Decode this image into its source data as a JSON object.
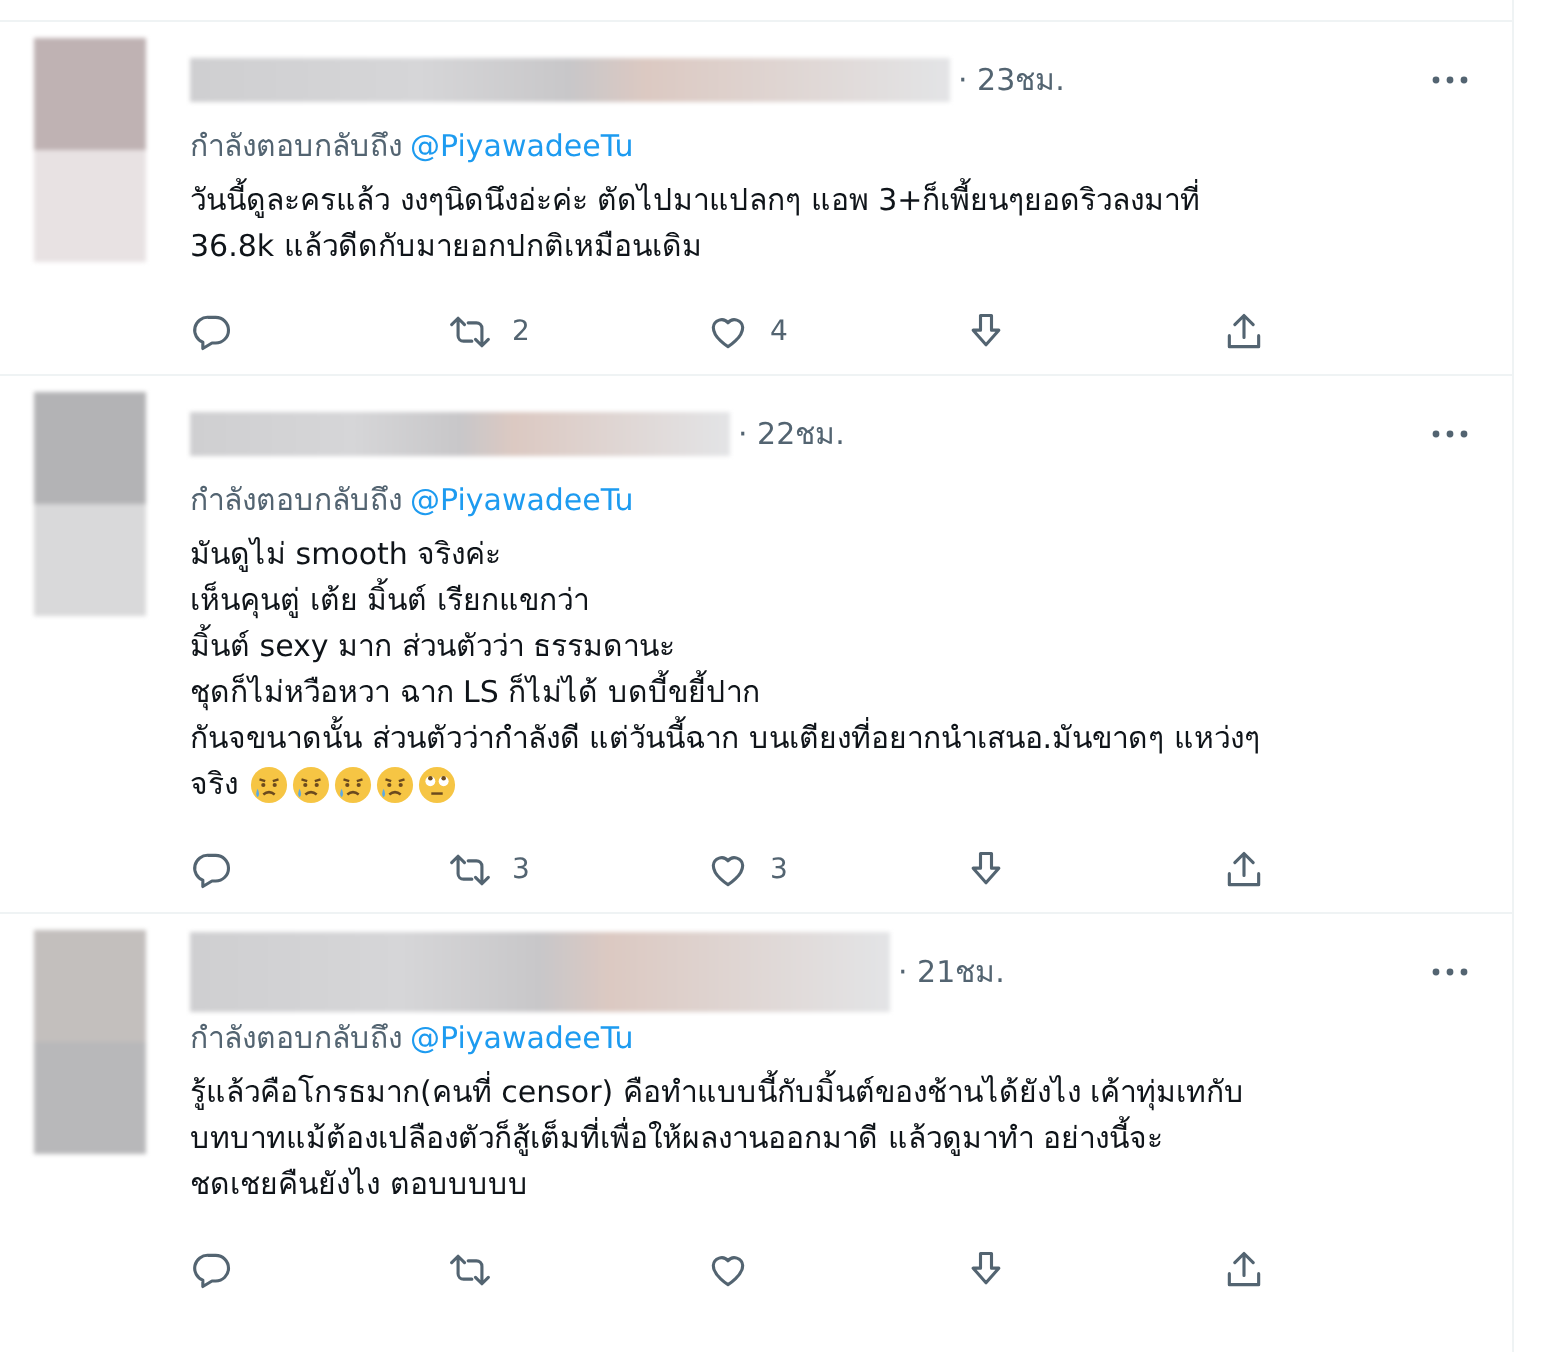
{
  "tweets": [
    {
      "time": "· 23ชม.",
      "reply_prefix": "กำลังตอบกลับถึง",
      "reply_handle": "@PiyawadeeTu",
      "body": [
        "วันนี้ดูละครแล้ว งงๆนิดนึงอ่ะค่ะ ตัดไปมาแปลกๆ แอพ 3+ก็เพี้ยนๆยอดริวลงมาที่",
        "36.8k แล้วดีดกับมายอกปกติเหมือนเดิม"
      ],
      "retweets": "2",
      "likes": "4"
    },
    {
      "time": "· 22ชม.",
      "reply_prefix": "กำลังตอบกลับถึง",
      "reply_handle": "@PiyawadeeTu",
      "body": [
        "มันดูไม่  smooth จริงค่ะ",
        "เห็นคุนตู่ เต้ย มิ้นต์ เรียกแขกว่า",
        "มิ้นต์ sexy มาก ส่วนตัวว่า ธรรมดานะ",
        "ชุดก็ไม่หวือหวา ฉาก LS ก็ไม่ได้ บดบี้ขยี้ปาก",
        "กันจขนาดนั้น ส่วนตัวว่ากำลังดี แต่วันนี้ฉาก บนเตียงที่อยากนำเสนอ.มันขาดๆ แหว่งๆ",
        "จริง"
      ],
      "emojis": [
        {
          "kind": "crying"
        },
        {
          "kind": "crying"
        },
        {
          "kind": "crying"
        },
        {
          "kind": "crying"
        },
        {
          "kind": "eye-roll"
        }
      ],
      "retweets": "3",
      "likes": "3"
    },
    {
      "time": "· 21ชม.",
      "reply_prefix": "กำลังตอบกลับถึง",
      "reply_handle": "@PiyawadeeTu",
      "body": [
        "รู้แล้วคือโกรธมาก(คนที่ censor) คือทำแบบนี้กับมิ้นต์ของช้านได้ยังไง เค้าทุ่มเทกับ",
        "บทบาทแม้ต้องเปลืองตัวก็สู้เต็มที่เพื่อให้ผลงานออกมาดี แล้วดูมาทำ อย่างนี้จะ",
        "ชดเชยคืนยังไง ตอบบบบบ"
      ]
    }
  ]
}
